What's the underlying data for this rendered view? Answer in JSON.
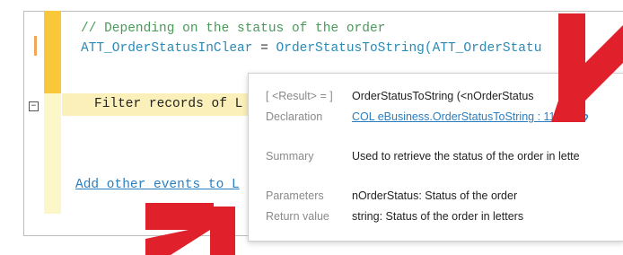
{
  "editor": {
    "comment_line": "// Depending on the status of the order",
    "assign_lhs": "ATT_OrderStatusInClear",
    "assign_op": " = ",
    "assign_func": "OrderStatusToString",
    "assign_arg": "(ATT_OrderStatu",
    "filter_line": "Filter records of L",
    "add_events_link": "Add other events to L",
    "collapse_symbol": "−"
  },
  "tooltip": {
    "result_label": "[ <Result> = ]",
    "result_value": "OrderStatusToString (<nOrderStatus",
    "declaration_label": "Declaration",
    "declaration_link": "COL eBusiness.OrderStatusToString : 11",
    "summary_label": "Summary",
    "summary_value": "Used to retrieve the status of the order in lette",
    "parameters_label": "Parameters",
    "parameters_value": "nOrderStatus: Status of the order",
    "return_label": "Return value",
    "return_value": "string: Status of the order in letters",
    "link_icon": "link-icon"
  },
  "colors": {
    "comment": "#4a9a5a",
    "identifier": "#2a8ab6",
    "link": "#2a7ec0",
    "arrow_red": "#e0202b",
    "margin_yellow": "#f8c73a"
  }
}
